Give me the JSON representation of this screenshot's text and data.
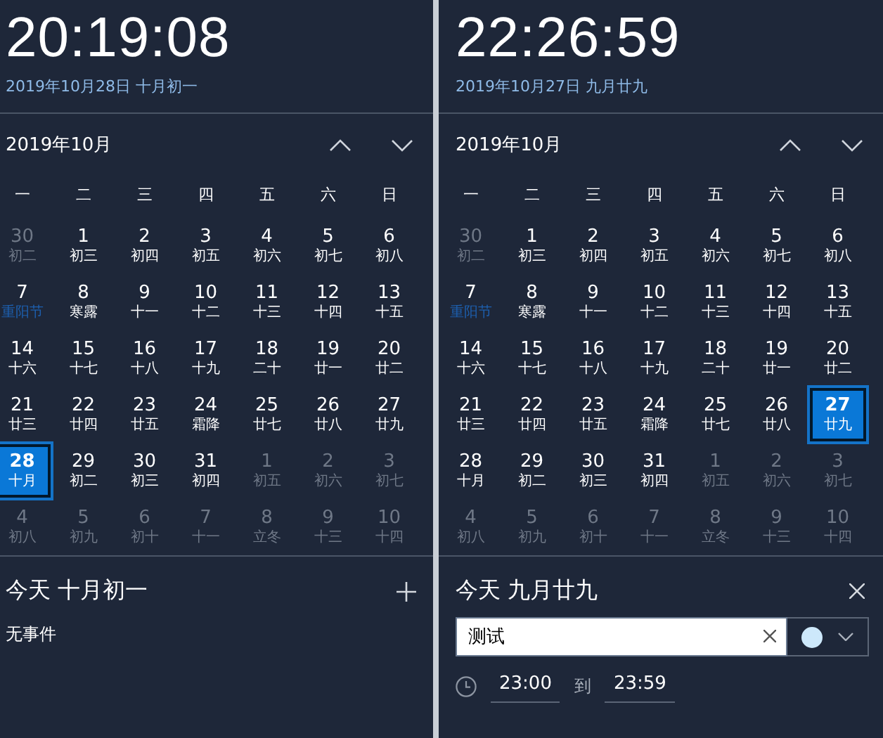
{
  "panels": [
    {
      "time": "20:19:08",
      "date": "2019年10月28日 十月初一",
      "month": "2019年10月",
      "weekdays": [
        "一",
        "二",
        "三",
        "四",
        "五",
        "六",
        "日"
      ],
      "weeks": [
        [
          {
            "day": "30",
            "lunar": "初二",
            "in_month": false,
            "selected": false,
            "festival": false
          },
          {
            "day": "1",
            "lunar": "初三",
            "in_month": true,
            "selected": false,
            "festival": false
          },
          {
            "day": "2",
            "lunar": "初四",
            "in_month": true,
            "selected": false,
            "festival": false
          },
          {
            "day": "3",
            "lunar": "初五",
            "in_month": true,
            "selected": false,
            "festival": false
          },
          {
            "day": "4",
            "lunar": "初六",
            "in_month": true,
            "selected": false,
            "festival": false
          },
          {
            "day": "5",
            "lunar": "初七",
            "in_month": true,
            "selected": false,
            "festival": false
          },
          {
            "day": "6",
            "lunar": "初八",
            "in_month": true,
            "selected": false,
            "festival": false
          }
        ],
        [
          {
            "day": "7",
            "lunar": "重阳节",
            "in_month": true,
            "selected": false,
            "festival": true
          },
          {
            "day": "8",
            "lunar": "寒露",
            "in_month": true,
            "selected": false,
            "festival": false
          },
          {
            "day": "9",
            "lunar": "十一",
            "in_month": true,
            "selected": false,
            "festival": false
          },
          {
            "day": "10",
            "lunar": "十二",
            "in_month": true,
            "selected": false,
            "festival": false
          },
          {
            "day": "11",
            "lunar": "十三",
            "in_month": true,
            "selected": false,
            "festival": false
          },
          {
            "day": "12",
            "lunar": "十四",
            "in_month": true,
            "selected": false,
            "festival": false
          },
          {
            "day": "13",
            "lunar": "十五",
            "in_month": true,
            "selected": false,
            "festival": false
          }
        ],
        [
          {
            "day": "14",
            "lunar": "十六",
            "in_month": true,
            "selected": false,
            "festival": false
          },
          {
            "day": "15",
            "lunar": "十七",
            "in_month": true,
            "selected": false,
            "festival": false
          },
          {
            "day": "16",
            "lunar": "十八",
            "in_month": true,
            "selected": false,
            "festival": false
          },
          {
            "day": "17",
            "lunar": "十九",
            "in_month": true,
            "selected": false,
            "festival": false
          },
          {
            "day": "18",
            "lunar": "二十",
            "in_month": true,
            "selected": false,
            "festival": false
          },
          {
            "day": "19",
            "lunar": "廿一",
            "in_month": true,
            "selected": false,
            "festival": false
          },
          {
            "day": "20",
            "lunar": "廿二",
            "in_month": true,
            "selected": false,
            "festival": false
          }
        ],
        [
          {
            "day": "21",
            "lunar": "廿三",
            "in_month": true,
            "selected": false,
            "festival": false
          },
          {
            "day": "22",
            "lunar": "廿四",
            "in_month": true,
            "selected": false,
            "festival": false
          },
          {
            "day": "23",
            "lunar": "廿五",
            "in_month": true,
            "selected": false,
            "festival": false
          },
          {
            "day": "24",
            "lunar": "霜降",
            "in_month": true,
            "selected": false,
            "festival": false
          },
          {
            "day": "25",
            "lunar": "廿七",
            "in_month": true,
            "selected": false,
            "festival": false
          },
          {
            "day": "26",
            "lunar": "廿八",
            "in_month": true,
            "selected": false,
            "festival": false
          },
          {
            "day": "27",
            "lunar": "廿九",
            "in_month": true,
            "selected": false,
            "festival": false
          }
        ],
        [
          {
            "day": "28",
            "lunar": "十月",
            "in_month": true,
            "selected": true,
            "festival": false
          },
          {
            "day": "29",
            "lunar": "初二",
            "in_month": true,
            "selected": false,
            "festival": false
          },
          {
            "day": "30",
            "lunar": "初三",
            "in_month": true,
            "selected": false,
            "festival": false
          },
          {
            "day": "31",
            "lunar": "初四",
            "in_month": true,
            "selected": false,
            "festival": false
          },
          {
            "day": "1",
            "lunar": "初五",
            "in_month": false,
            "selected": false,
            "festival": false
          },
          {
            "day": "2",
            "lunar": "初六",
            "in_month": false,
            "selected": false,
            "festival": false
          },
          {
            "day": "3",
            "lunar": "初七",
            "in_month": false,
            "selected": false,
            "festival": false
          }
        ],
        [
          {
            "day": "4",
            "lunar": "初八",
            "in_month": false,
            "selected": false,
            "festival": false
          },
          {
            "day": "5",
            "lunar": "初九",
            "in_month": false,
            "selected": false,
            "festival": false
          },
          {
            "day": "6",
            "lunar": "初十",
            "in_month": false,
            "selected": false,
            "festival": false
          },
          {
            "day": "7",
            "lunar": "十一",
            "in_month": false,
            "selected": false,
            "festival": false
          },
          {
            "day": "8",
            "lunar": "立冬",
            "in_month": false,
            "selected": false,
            "festival": false
          },
          {
            "day": "9",
            "lunar": "十三",
            "in_month": false,
            "selected": false,
            "festival": false
          },
          {
            "day": "10",
            "lunar": "十四",
            "in_month": false,
            "selected": false,
            "festival": false
          }
        ]
      ],
      "agenda": {
        "kind": "empty",
        "title": "今天 十月初一",
        "message": "无事件"
      }
    },
    {
      "time": "22:26:59",
      "date": "2019年10月27日 九月廿九",
      "month": "2019年10月",
      "weekdays": [
        "一",
        "二",
        "三",
        "四",
        "五",
        "六",
        "日"
      ],
      "weeks": [
        [
          {
            "day": "30",
            "lunar": "初二",
            "in_month": false,
            "selected": false,
            "festival": false
          },
          {
            "day": "1",
            "lunar": "初三",
            "in_month": true,
            "selected": false,
            "festival": false
          },
          {
            "day": "2",
            "lunar": "初四",
            "in_month": true,
            "selected": false,
            "festival": false
          },
          {
            "day": "3",
            "lunar": "初五",
            "in_month": true,
            "selected": false,
            "festival": false
          },
          {
            "day": "4",
            "lunar": "初六",
            "in_month": true,
            "selected": false,
            "festival": false
          },
          {
            "day": "5",
            "lunar": "初七",
            "in_month": true,
            "selected": false,
            "festival": false
          },
          {
            "day": "6",
            "lunar": "初八",
            "in_month": true,
            "selected": false,
            "festival": false
          }
        ],
        [
          {
            "day": "7",
            "lunar": "重阳节",
            "in_month": true,
            "selected": false,
            "festival": true
          },
          {
            "day": "8",
            "lunar": "寒露",
            "in_month": true,
            "selected": false,
            "festival": false
          },
          {
            "day": "9",
            "lunar": "十一",
            "in_month": true,
            "selected": false,
            "festival": false
          },
          {
            "day": "10",
            "lunar": "十二",
            "in_month": true,
            "selected": false,
            "festival": false
          },
          {
            "day": "11",
            "lunar": "十三",
            "in_month": true,
            "selected": false,
            "festival": false
          },
          {
            "day": "12",
            "lunar": "十四",
            "in_month": true,
            "selected": false,
            "festival": false
          },
          {
            "day": "13",
            "lunar": "十五",
            "in_month": true,
            "selected": false,
            "festival": false
          }
        ],
        [
          {
            "day": "14",
            "lunar": "十六",
            "in_month": true,
            "selected": false,
            "festival": false
          },
          {
            "day": "15",
            "lunar": "十七",
            "in_month": true,
            "selected": false,
            "festival": false
          },
          {
            "day": "16",
            "lunar": "十八",
            "in_month": true,
            "selected": false,
            "festival": false
          },
          {
            "day": "17",
            "lunar": "十九",
            "in_month": true,
            "selected": false,
            "festival": false
          },
          {
            "day": "18",
            "lunar": "二十",
            "in_month": true,
            "selected": false,
            "festival": false
          },
          {
            "day": "19",
            "lunar": "廿一",
            "in_month": true,
            "selected": false,
            "festival": false
          },
          {
            "day": "20",
            "lunar": "廿二",
            "in_month": true,
            "selected": false,
            "festival": false
          }
        ],
        [
          {
            "day": "21",
            "lunar": "廿三",
            "in_month": true,
            "selected": false,
            "festival": false
          },
          {
            "day": "22",
            "lunar": "廿四",
            "in_month": true,
            "selected": false,
            "festival": false
          },
          {
            "day": "23",
            "lunar": "廿五",
            "in_month": true,
            "selected": false,
            "festival": false
          },
          {
            "day": "24",
            "lunar": "霜降",
            "in_month": true,
            "selected": false,
            "festival": false
          },
          {
            "day": "25",
            "lunar": "廿七",
            "in_month": true,
            "selected": false,
            "festival": false
          },
          {
            "day": "26",
            "lunar": "廿八",
            "in_month": true,
            "selected": false,
            "festival": false
          },
          {
            "day": "27",
            "lunar": "廿九",
            "in_month": true,
            "selected": true,
            "festival": false
          }
        ],
        [
          {
            "day": "28",
            "lunar": "十月",
            "in_month": true,
            "selected": false,
            "festival": false
          },
          {
            "day": "29",
            "lunar": "初二",
            "in_month": true,
            "selected": false,
            "festival": false
          },
          {
            "day": "30",
            "lunar": "初三",
            "in_month": true,
            "selected": false,
            "festival": false
          },
          {
            "day": "31",
            "lunar": "初四",
            "in_month": true,
            "selected": false,
            "festival": false
          },
          {
            "day": "1",
            "lunar": "初五",
            "in_month": false,
            "selected": false,
            "festival": false
          },
          {
            "day": "2",
            "lunar": "初六",
            "in_month": false,
            "selected": false,
            "festival": false
          },
          {
            "day": "3",
            "lunar": "初七",
            "in_month": false,
            "selected": false,
            "festival": false
          }
        ],
        [
          {
            "day": "4",
            "lunar": "初八",
            "in_month": false,
            "selected": false,
            "festival": false
          },
          {
            "day": "5",
            "lunar": "初九",
            "in_month": false,
            "selected": false,
            "festival": false
          },
          {
            "day": "6",
            "lunar": "初十",
            "in_month": false,
            "selected": false,
            "festival": false
          },
          {
            "day": "7",
            "lunar": "十一",
            "in_month": false,
            "selected": false,
            "festival": false
          },
          {
            "day": "8",
            "lunar": "立冬",
            "in_month": false,
            "selected": false,
            "festival": false
          },
          {
            "day": "9",
            "lunar": "十三",
            "in_month": false,
            "selected": false,
            "festival": false
          },
          {
            "day": "10",
            "lunar": "十四",
            "in_month": false,
            "selected": false,
            "festival": false
          }
        ]
      ],
      "agenda": {
        "kind": "editor",
        "title": "今天 九月廿九",
        "value": "测试",
        "start": "23:00",
        "separator": "到",
        "end": "23:59"
      }
    }
  ]
}
